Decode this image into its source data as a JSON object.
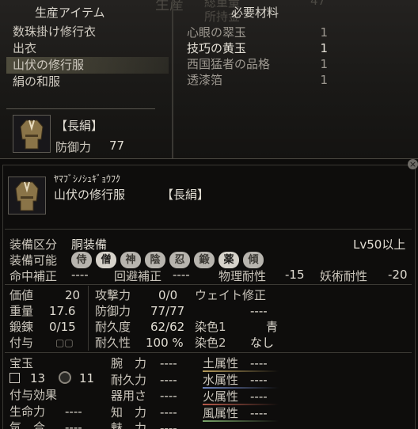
{
  "top": {
    "bg_title": "生産",
    "bg_total": "総重量",
    "bg_owned": "所持金",
    "bg_number": "47",
    "items_header": "生産アイテム",
    "materials_header": "必要材料",
    "items": [
      {
        "label": "数珠掛け修行衣",
        "selected": false
      },
      {
        "label": "出衣",
        "selected": false
      },
      {
        "label": "山伏の修行服",
        "selected": true
      },
      {
        "label": "絹の和服",
        "selected": false
      }
    ],
    "materials": [
      {
        "name": "心眼の翠玉",
        "qty": "1",
        "have": false
      },
      {
        "name": "技巧の黄玉",
        "qty": "1",
        "have": true
      },
      {
        "name": "西国猛者の品格",
        "qty": "1",
        "have": false
      },
      {
        "name": "透漆箔",
        "qty": "1",
        "have": false
      }
    ],
    "preview": {
      "grade": "【長絹】",
      "stat_label": "防御力",
      "stat_value": "77"
    }
  },
  "detail": {
    "kana": "ﾔﾏﾌﾞｼﾉｼｭｷﾞｮｳﾌｸ",
    "name": "山伏の修行服",
    "grade": "【長絹】",
    "equip_slot_label": "装備区分",
    "equip_slot_value": "胴装備",
    "level_req": "Lv50以上",
    "equip_classes_label": "装備可能",
    "classes": [
      {
        "label": "侍",
        "active": false
      },
      {
        "label": "僧",
        "active": true
      },
      {
        "label": "神",
        "active": false
      },
      {
        "label": "陰",
        "active": false
      },
      {
        "label": "忍",
        "active": false
      },
      {
        "label": "鍛",
        "active": false
      },
      {
        "label": "薬",
        "active": true
      },
      {
        "label": "傾",
        "active": false
      }
    ],
    "corrections": {
      "hit_label": "命中補正",
      "hit_value": "----",
      "evade_label": "回避補正",
      "evade_value": "----",
      "phys_label": "物理耐性",
      "phys_value": "-15",
      "magic_label": "妖術耐性",
      "magic_value": "-20"
    },
    "stats": {
      "price_label": "価値",
      "price_value": "20",
      "weight_label": "重量",
      "weight_value": "17.6",
      "forge_label": "鍛錬",
      "forge_value": "0/15",
      "grant_label": "付与",
      "grant_value": "▢▢",
      "attack_label": "攻撃力",
      "attack_value": "0/0",
      "defense_label": "防御力",
      "defense_value": "77/77",
      "dura_label": "耐久度",
      "dura_value": "62/62",
      "resist_label": "耐久性",
      "resist_value": "100 %",
      "weight_mod_label": "ウェイト修正",
      "weight_mod_value": "----",
      "dye1_label": "染色1",
      "dye1_value": "青",
      "dye2_label": "染色2",
      "dye2_value": "なし"
    },
    "gems": {
      "label": "宝玉",
      "square_count": "13",
      "circle_count": "11",
      "effect_label": "付与効果"
    },
    "attrs": [
      {
        "label": "腕　力",
        "value": "----"
      },
      {
        "label": "耐久力",
        "value": "----"
      },
      {
        "label": "器用さ",
        "value": "----"
      },
      {
        "label": "知　力",
        "value": "----"
      },
      {
        "label": "魅　力",
        "value": "----"
      }
    ],
    "elements": [
      {
        "label": "土属性",
        "value": "----",
        "color": "#b49a5a"
      },
      {
        "label": "水属性",
        "value": "----",
        "color": "#6a7fb8"
      },
      {
        "label": "火属性",
        "value": "----",
        "color": "#b85a4a"
      },
      {
        "label": "風属性",
        "value": "----",
        "color": "#7aa56a"
      }
    ],
    "life_label": "生命力",
    "life_value": "----",
    "ki_label": "気　合",
    "ki_value": "----"
  }
}
